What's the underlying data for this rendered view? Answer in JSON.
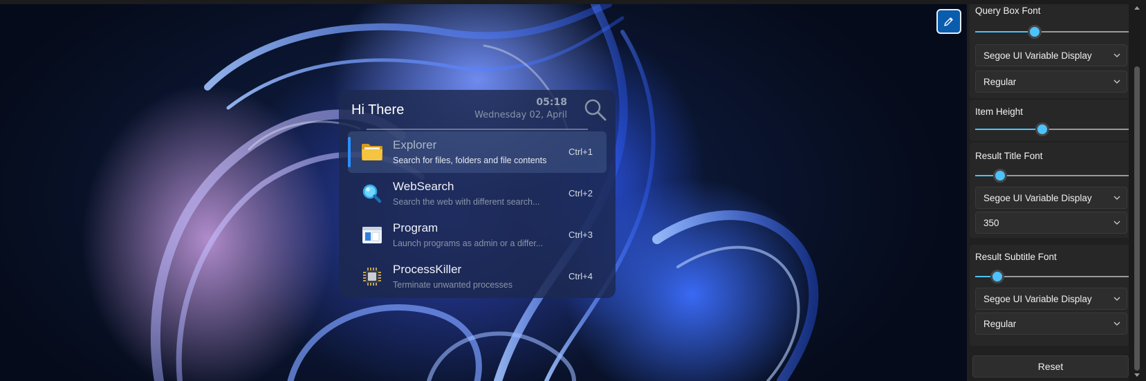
{
  "launcher": {
    "greeting": "Hi There",
    "time": "05:18",
    "date": "Wednesday 02, April",
    "results": [
      {
        "title": "Explorer",
        "subtitle": "Search for files, folders and file contents",
        "shortcut": "Ctrl+1",
        "icon": "folder-icon",
        "selected": true
      },
      {
        "title": "WebSearch",
        "subtitle": "Search the web with different search...",
        "shortcut": "Ctrl+2",
        "icon": "magnifier-icon",
        "selected": false
      },
      {
        "title": "Program",
        "subtitle": "Launch programs as admin or a differ...",
        "shortcut": "Ctrl+3",
        "icon": "program-window-icon",
        "selected": false
      },
      {
        "title": "ProcessKiller",
        "subtitle": "Terminate unwanted processes",
        "shortcut": "Ctrl+4",
        "icon": "cpu-chip-icon",
        "selected": false
      }
    ]
  },
  "settings": {
    "query_box_font": {
      "label": "Query Box Font",
      "size_level": 0.38,
      "family": "Segoe UI Variable Display",
      "weight": "Regular"
    },
    "item_height": {
      "label": "Item Height",
      "level": 0.43
    },
    "result_title_font": {
      "label": "Result Title Font",
      "size_level": 0.16,
      "family": "Segoe UI Variable Display",
      "weight": "350"
    },
    "result_subtitle_font": {
      "label": "Result Subtitle Font",
      "size_level": 0.14,
      "family": "Segoe UI Variable Display",
      "weight": "Regular"
    },
    "reset_label": "Reset"
  },
  "colors": {
    "accent": "#4cc2ff",
    "edit_button": "#0a5cad",
    "selection_bar": "#2b8fff",
    "panel_bg": "#202020"
  }
}
